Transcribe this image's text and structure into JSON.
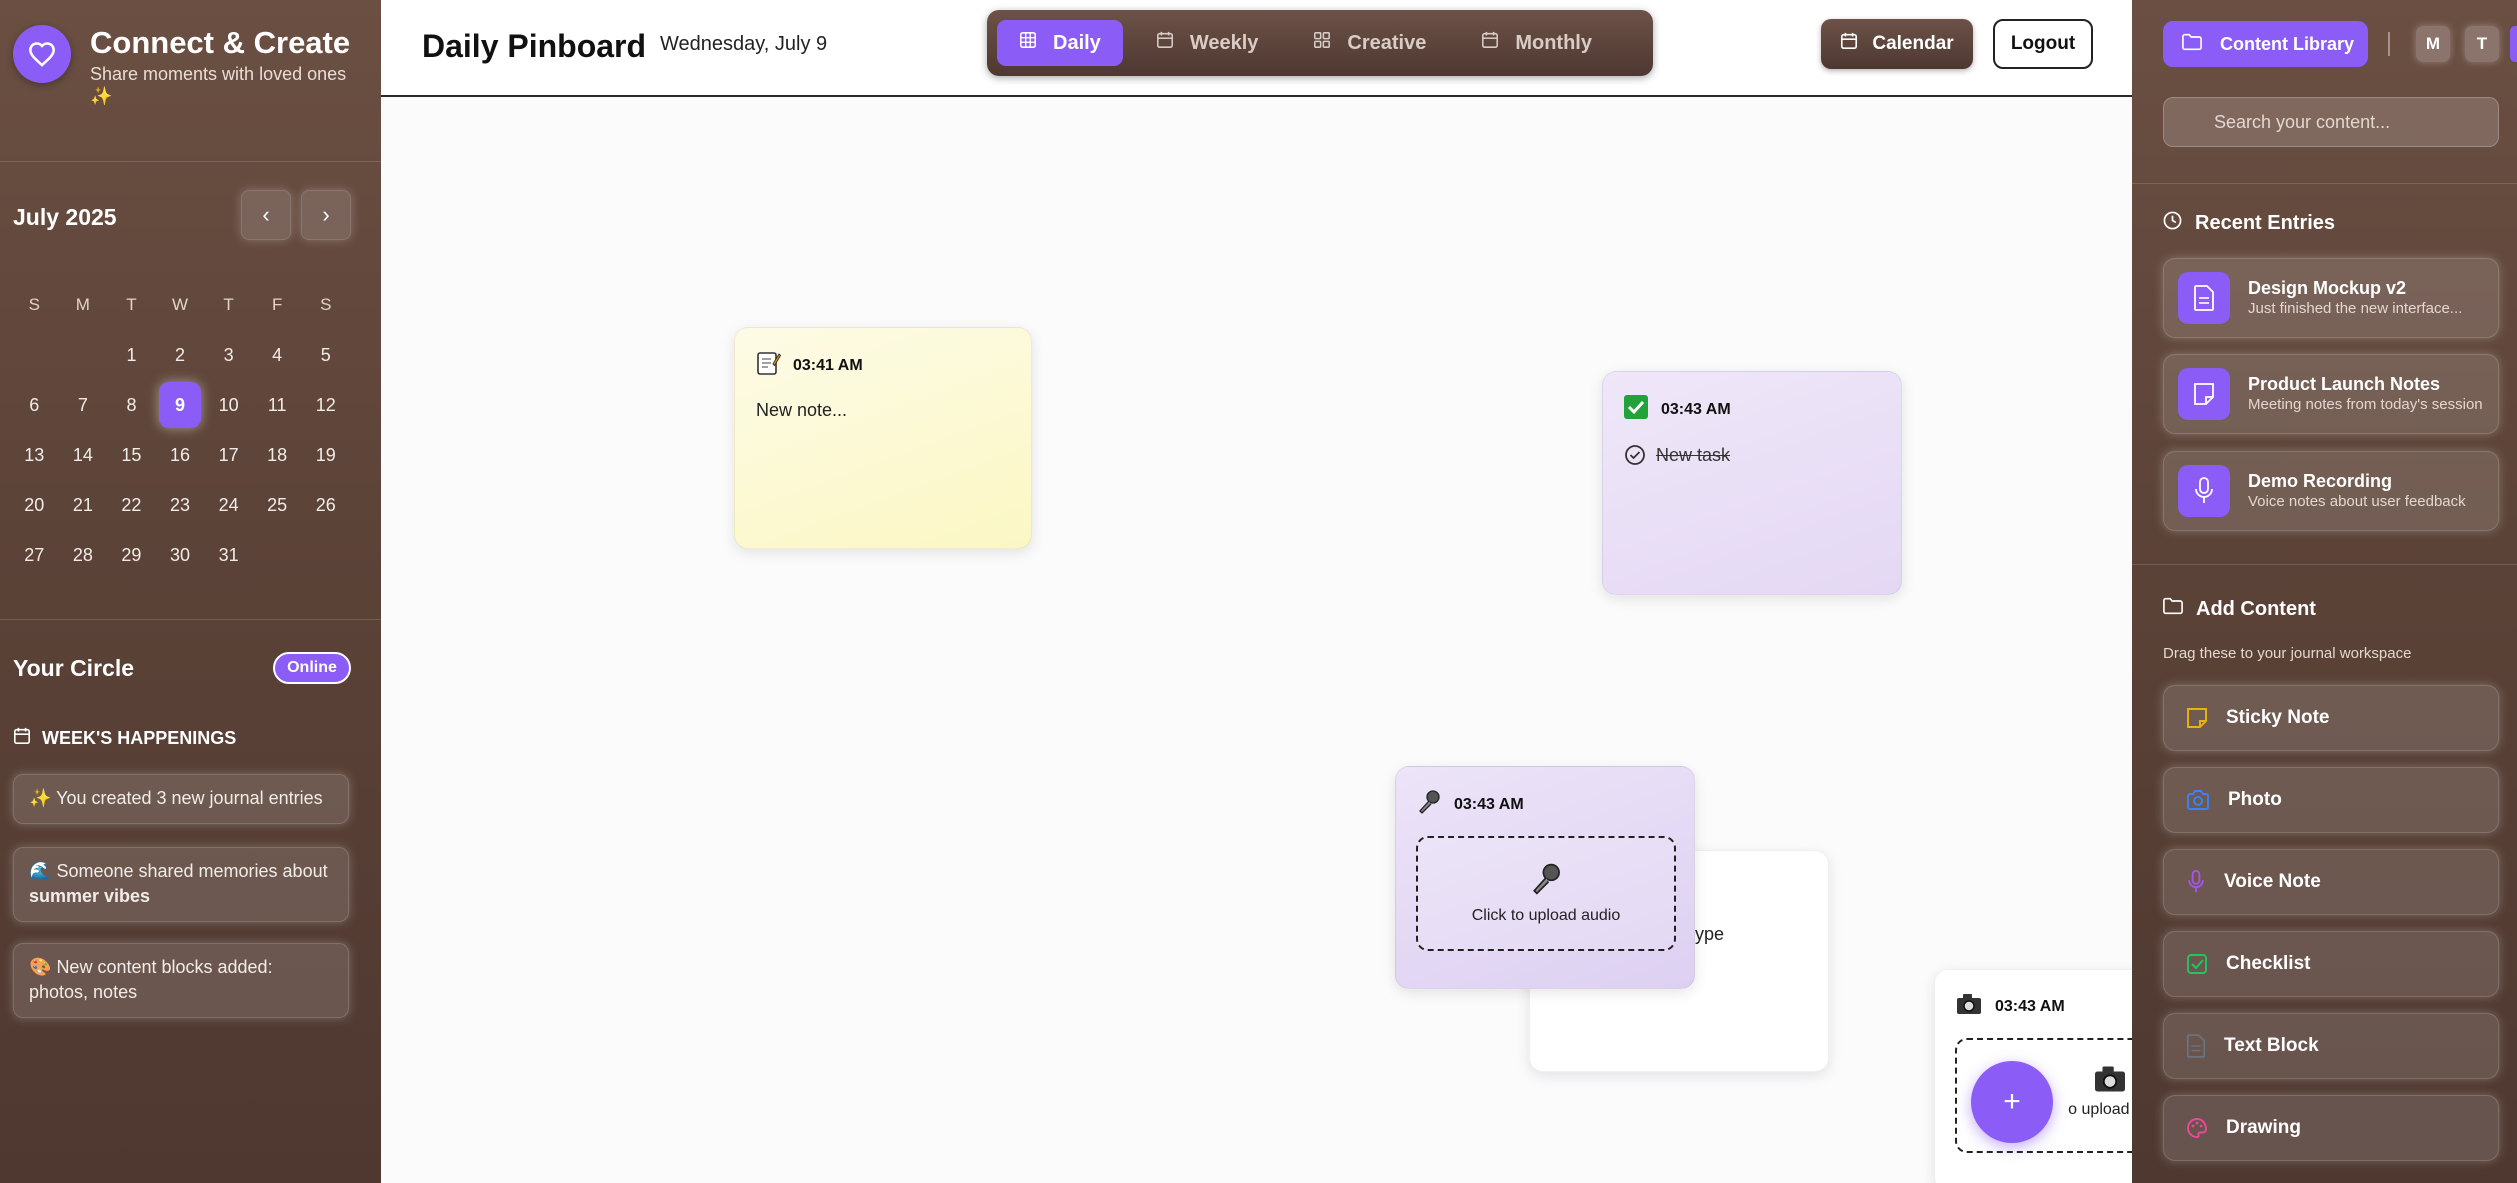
{
  "brand": {
    "title": "Connect & Create",
    "subtitle": "Share moments with loved ones ✨"
  },
  "calendar": {
    "month_label": "July 2025",
    "prev": "‹",
    "next": "›",
    "weekdays": [
      "S",
      "M",
      "T",
      "W",
      "T",
      "F",
      "S"
    ],
    "weeks": [
      [
        "",
        "",
        "1",
        "2",
        "3",
        "4",
        "5"
      ],
      [
        "6",
        "7",
        "8",
        "9",
        "10",
        "11",
        "12"
      ],
      [
        "13",
        "14",
        "15",
        "16",
        "17",
        "18",
        "19"
      ],
      [
        "20",
        "21",
        "22",
        "23",
        "24",
        "25",
        "26"
      ],
      [
        "27",
        "28",
        "29",
        "30",
        "31",
        "",
        ""
      ]
    ],
    "selected_day": "9"
  },
  "circle": {
    "title": "Your Circle",
    "status": "Online",
    "week_title": "WEEK'S HAPPENINGS",
    "items": [
      {
        "emoji": "✨",
        "text": "You created 3 new journal entries",
        "bold": ""
      },
      {
        "emoji": "🌊",
        "text": "Someone shared memories about",
        "bold": "summer vibes"
      },
      {
        "emoji": "🎨",
        "text": "New content blocks added: photos, notes",
        "bold": ""
      }
    ]
  },
  "header": {
    "title": "Daily Pinboard",
    "date": "Wednesday, July 9",
    "tabs": [
      {
        "label": "Daily",
        "icon": "grid-icon",
        "active": true
      },
      {
        "label": "Weekly",
        "icon": "calendar-icon",
        "active": false
      },
      {
        "label": "Creative",
        "icon": "layout-icon",
        "active": false
      },
      {
        "label": "Monthly",
        "icon": "calendar-icon",
        "active": false
      }
    ],
    "calendar_button": "Calendar",
    "logout_button": "Logout"
  },
  "board": {
    "note": {
      "time": "03:41 AM",
      "text": "New note..."
    },
    "task": {
      "time": "03:43 AM",
      "text": "New task",
      "done": true
    },
    "audio": {
      "time": "03:43 AM",
      "upload_label": "Click to upload audio"
    },
    "select_card": {
      "text": "ent type"
    },
    "photo": {
      "time": "03:43 AM",
      "upload_label": "o upload ph"
    },
    "fab": "+"
  },
  "right": {
    "library_button": "Content Library",
    "mini_buttons": [
      "M",
      "T"
    ],
    "search_placeholder": "Search your content...",
    "recent_title": "Recent Entries",
    "recent": [
      {
        "title": "Design Mockup v2",
        "subtitle": "Just finished the new interface...",
        "icon": "document-icon"
      },
      {
        "title": "Product Launch Notes",
        "subtitle": "Meeting notes from today's session",
        "icon": "note-icon"
      },
      {
        "title": "Demo Recording",
        "subtitle": "Voice notes about user feedback",
        "icon": "mic-icon"
      }
    ],
    "add_title": "Add Content",
    "add_hint": "Drag these to your journal workspace",
    "tools": [
      {
        "label": "Sticky Note",
        "icon": "sticky-note-icon",
        "color": "#eab308"
      },
      {
        "label": "Photo",
        "icon": "camera-icon",
        "color": "#3b82f6"
      },
      {
        "label": "Voice Note",
        "icon": "mic-icon",
        "color": "#a855f7"
      },
      {
        "label": "Checklist",
        "icon": "checklist-icon",
        "color": "#22c55e"
      },
      {
        "label": "Text Block",
        "icon": "text-icon",
        "color": "#6b7280"
      },
      {
        "label": "Drawing",
        "icon": "palette-icon",
        "color": "#ec4899"
      }
    ]
  },
  "colors": {
    "accent": "#8b5cf6",
    "sidebar": "#5c4338",
    "note_yellow": "#fdf9c4",
    "card_lavender": "#e9ddf7"
  }
}
